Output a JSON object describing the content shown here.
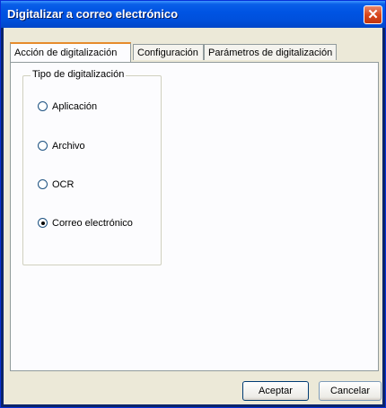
{
  "window": {
    "title": "Digitalizar a correo electrónico"
  },
  "tabs": [
    {
      "label": "Acción de digitalización",
      "active": true
    },
    {
      "label": "Configuración",
      "active": false
    },
    {
      "label": "Parámetros de digitalización",
      "active": false
    }
  ],
  "scan_type": {
    "group_label": "Tipo de digitalización",
    "options": [
      {
        "label": "Aplicación",
        "selected": false
      },
      {
        "label": "Archivo",
        "selected": false
      },
      {
        "label": "OCR",
        "selected": false
      },
      {
        "label": "Correo electrónico",
        "selected": true
      }
    ]
  },
  "buttons": {
    "accept": "Aceptar",
    "cancel": "Cancelar"
  }
}
